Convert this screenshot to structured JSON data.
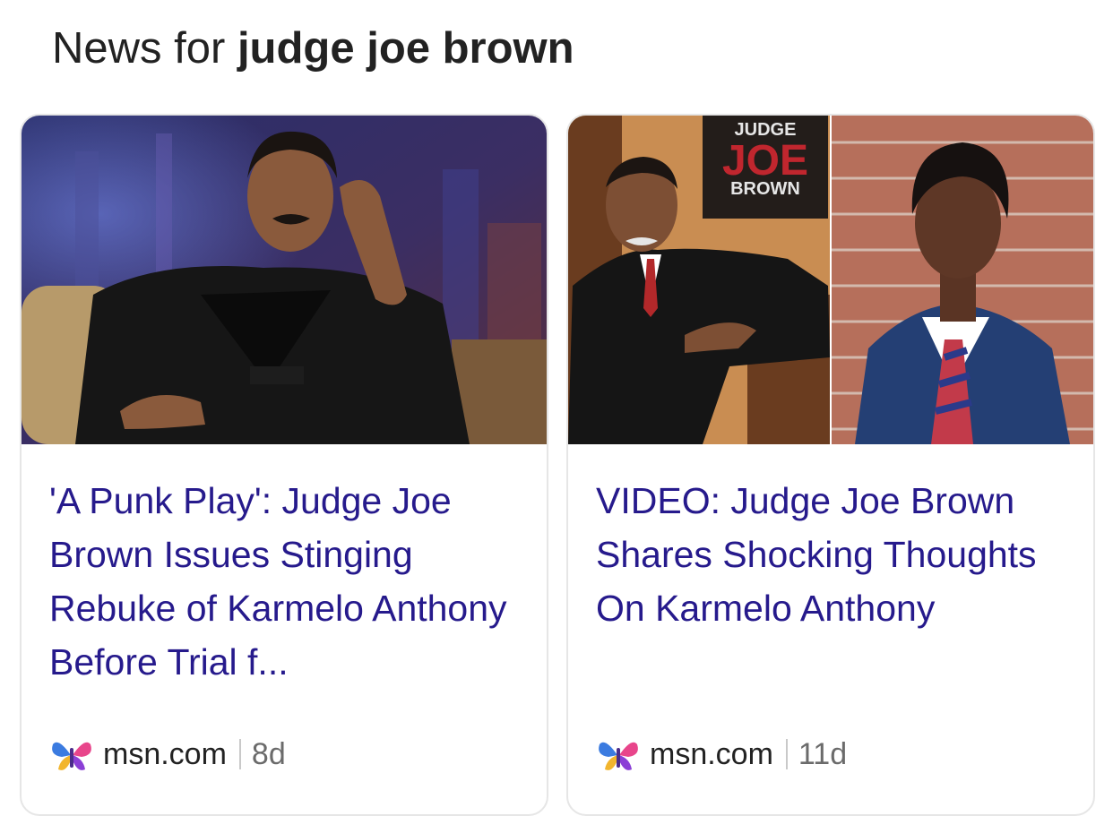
{
  "header": {
    "prefix": "News for ",
    "query": "judge joe brown"
  },
  "cards": [
    {
      "image": "judge-joe-brown-talk-show-photo",
      "headline": "'A Punk Play': Judge Joe Brown Issues Stinging Rebuke of Karmelo Anthony Before Trial f...",
      "source": "msn.com",
      "age": "8d"
    },
    {
      "image": "judge-joe-brown-and-karmelo-anthony-split-photo",
      "image_text": {
        "line1": "JUDGE",
        "line2": "JOE",
        "line3": "BROWN",
        "partial": "JU"
      },
      "headline": "VIDEO: Judge Joe Brown Shares Shocking Thoughts On Karmelo Anthony",
      "source": "msn.com",
      "age": "11d"
    }
  ],
  "colors": {
    "headline": "#261a8c",
    "source": "#222222",
    "age": "#6b6b6b",
    "border": "#e6e6e6"
  },
  "icons": {
    "source_logo": "msn-butterfly-icon"
  }
}
